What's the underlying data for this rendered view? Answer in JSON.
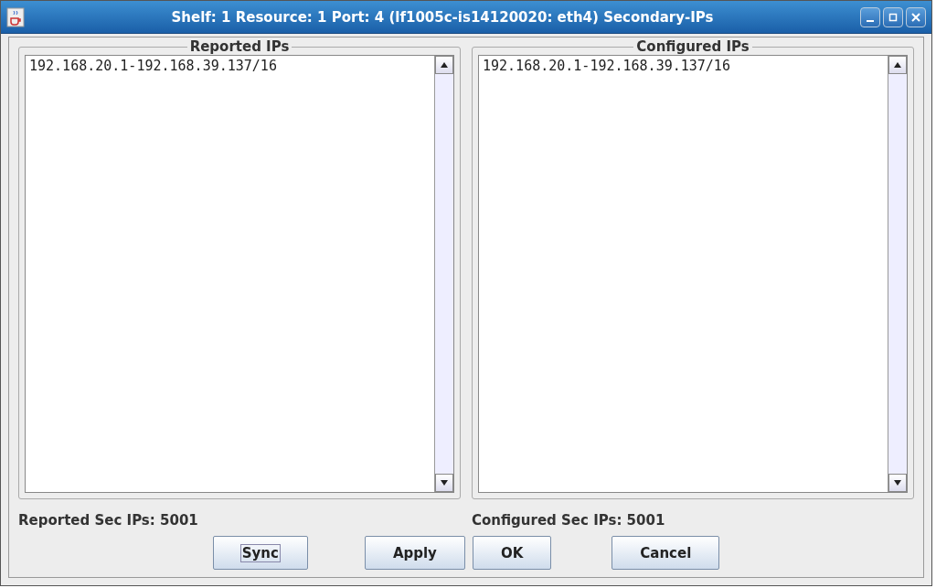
{
  "window": {
    "title": "Shelf: 1 Resource: 1 Port: 4 (lf1005c-is14120020: eth4) Secondary-IPs"
  },
  "panels": [
    {
      "title": "Reported IPs",
      "items": [
        "192.168.20.1-192.168.39.137/16"
      ],
      "count": "Reported Sec IPs: 5001"
    },
    {
      "title": "Configured IPs",
      "items": [
        "192.168.20.1-192.168.39.137/16"
      ],
      "count": "Configured Sec IPs: 5001"
    }
  ],
  "buttons": [
    {
      "label": "Sync",
      "focused": true
    },
    {
      "label": "Apply",
      "focused": false
    },
    {
      "label": "OK",
      "focused": false
    },
    {
      "label": "Cancel",
      "focused": false
    }
  ]
}
